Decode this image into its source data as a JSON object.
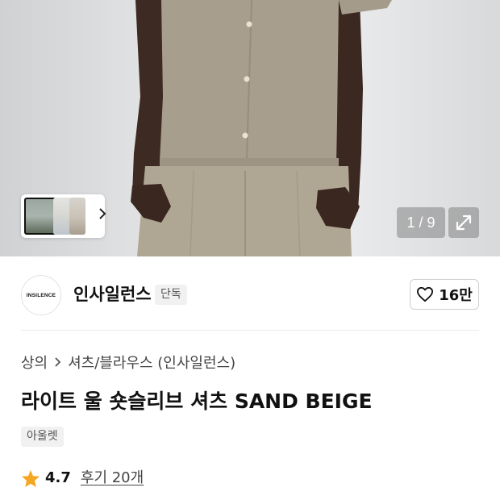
{
  "gallery": {
    "counter": "1 / 9",
    "thumbnail_count_visible": 3
  },
  "brand": {
    "logo_text": "INSILENCE",
    "name": "인사일런스",
    "badge": "단독",
    "likes": "16만"
  },
  "product": {
    "breadcrumb": [
      "상의",
      "셔츠/블라우스 (인사일런스)"
    ],
    "title": "라이트 울 숏슬리브 셔츠 SAND BEIGE",
    "badge": "아울렛",
    "rating": "4.7",
    "reviews_label": "후기 20개"
  },
  "colors": {
    "star": "#f5a623",
    "fabric": "#a89e8e",
    "background": "#ffffff"
  },
  "icons": {
    "thumb_next": "chevron-right-icon",
    "expand": "expand-icon",
    "like": "heart-outline-icon",
    "breadcrumb_sep": "chevron-right-icon",
    "rating": "star-icon"
  }
}
